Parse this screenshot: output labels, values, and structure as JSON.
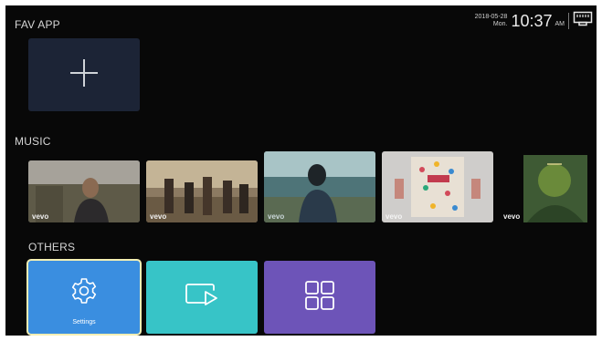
{
  "sections": {
    "fav": "FAV APP",
    "music": "MUSIC",
    "others": "OTHERS"
  },
  "status": {
    "date": "2018-05-28",
    "weekday": "Mon.",
    "time": "10:37",
    "ampm": "AM",
    "network_icon": "ethernet-icon"
  },
  "fav_apps": {
    "add_icon": "plus-icon"
  },
  "music": {
    "items": [
      {
        "badge": "vevo"
      },
      {
        "badge": "vevo"
      },
      {
        "badge": "vevo"
      },
      {
        "badge": "vevo"
      },
      {
        "badge": "vevo"
      }
    ]
  },
  "others": {
    "settings_label": "Settings",
    "settings_icon": "gear-icon",
    "cast_icon": "screen-cast-icon",
    "apps_icon": "app-grid-icon"
  },
  "colors": {
    "background": "#080808",
    "fav_tile": "#1c2436",
    "settings": "#3a8ee0",
    "cast": "#37c4c7",
    "apps": "#6d54b8",
    "focus_border": "#f3efb4"
  }
}
